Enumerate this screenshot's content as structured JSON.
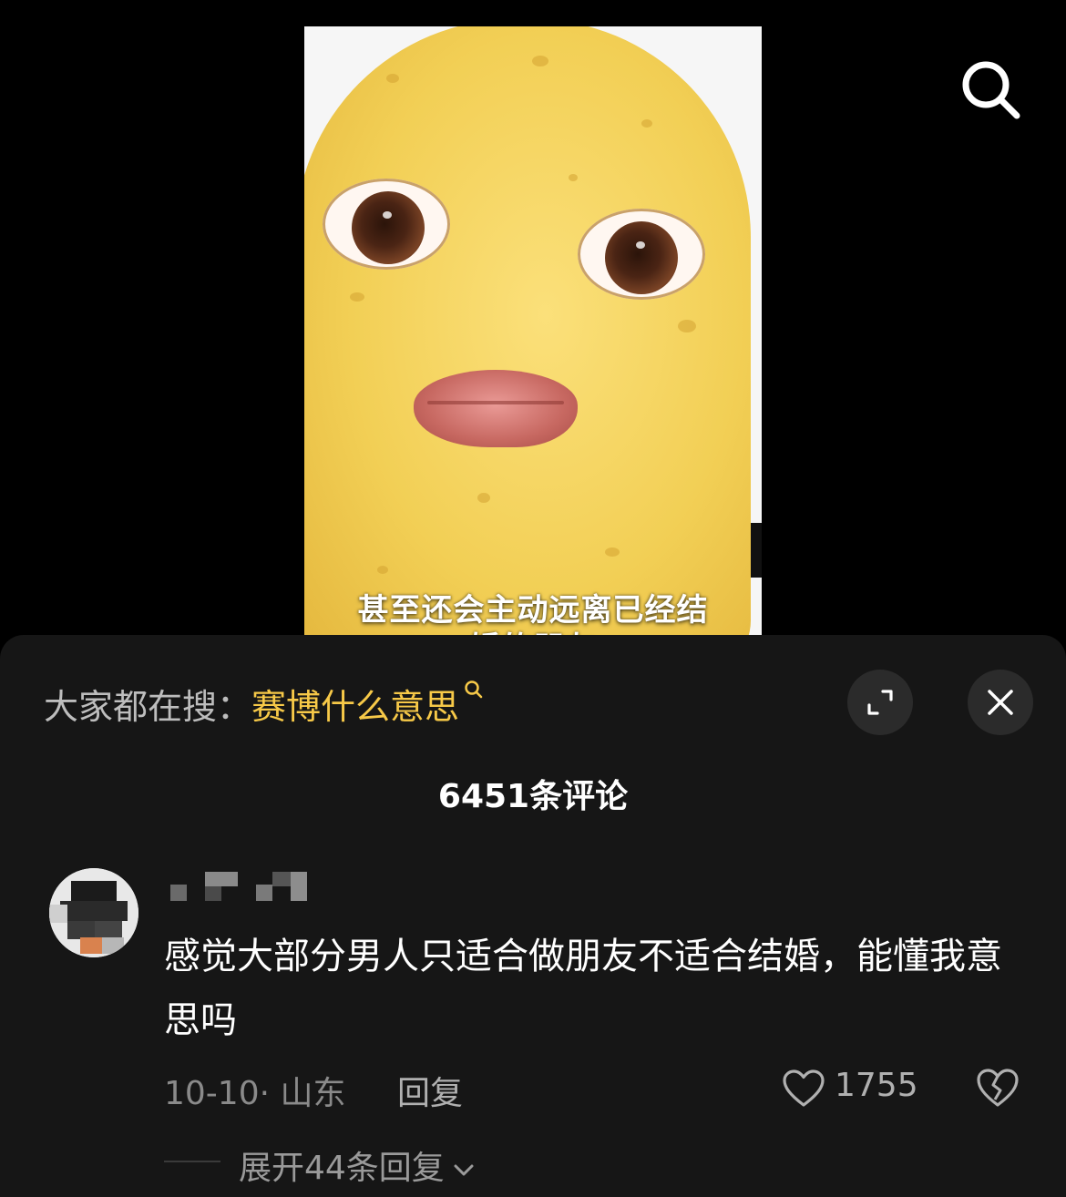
{
  "video": {
    "subtitle_line1": "甚至还会主动远离已经结",
    "subtitle_line2": "婚的朋友"
  },
  "top_bar": {
    "search_icon": "search-icon"
  },
  "comments_panel": {
    "hot_search_prefix": "大家都在搜：",
    "hot_search_term": "赛博什么意思",
    "expand_icon": "expand-icon",
    "close_icon": "close-icon",
    "comment_count_label": "6451条评论",
    "comment": {
      "text": "感觉大部分男人只适合做朋友不适合结婚，能懂我意思吗",
      "date": "10-10",
      "location": "山东",
      "reply_label": "回复",
      "like_count": "1755",
      "expand_replies_label": "展开44条回复"
    }
  },
  "colors": {
    "background": "#000000",
    "sheet": "#161616",
    "accent": "#f7c948"
  }
}
